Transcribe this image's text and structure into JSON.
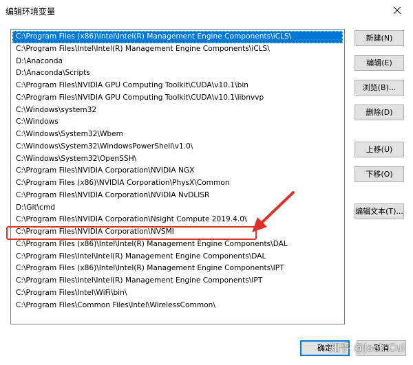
{
  "window": {
    "title": "编辑环境变量"
  },
  "paths": [
    "C:\\Program Files (x86)\\Intel\\Intel(R) Management Engine Components\\iCLS\\",
    "C:\\Program Files\\Intel\\Intel(R) Management Engine Components\\iCLS\\",
    "D:\\Anaconda",
    "D:\\Anaconda\\Scripts",
    "C:\\Program Files\\NVIDIA GPU Computing Toolkit\\CUDA\\v10.1\\bin",
    "C:\\Program Files\\NVIDIA GPU Computing Toolkit\\CUDA\\v10.1\\libnvvp",
    "C:\\Windows\\system32",
    "C:\\Windows",
    "C:\\Windows\\System32\\Wbem",
    "C:\\Windows\\System32\\WindowsPowerShell\\v1.0\\",
    "C:\\Windows\\System32\\OpenSSH\\",
    "C:\\Program Files\\NVIDIA Corporation\\NVIDIA NGX",
    "C:\\Program Files (x86)\\NVIDIA Corporation\\PhysX\\Common",
    "C:\\Program Files\\NVIDIA Corporation\\NVIDIA NvDLISR",
    "D:\\Git\\cmd",
    "C:\\Program Files\\NVIDIA Corporation\\Nsight Compute 2019.4.0\\",
    "C:\\Program Files\\NVIDIA Corporation\\NVSMI",
    "C:\\Program Files (x86)\\Intel\\Intel(R) Management Engine Components\\DAL",
    "C:\\Program Files\\Intel\\Intel(R) Management Engine Components\\DAL",
    "C:\\Program Files (x86)\\Intel\\Intel(R) Management Engine Components\\IPT",
    "C:\\Program Files\\Intel\\Intel(R) Management Engine Components\\IPT",
    "C:\\Program Files\\Intel\\WiFi\\bin\\",
    "C:\\Program Files\\Common Files\\Intel\\WirelessCommon\\"
  ],
  "selected_index": 0,
  "highlighted_index": 16,
  "buttons": {
    "new": "新建(N)",
    "edit": "编辑(E)",
    "browse": "浏览(B)...",
    "delete": "删除(D)",
    "move_up": "上移(U)",
    "move_down": "下移(O)",
    "edit_text": "编辑文本(T)...",
    "ok": "确定",
    "cancel": "取消"
  },
  "annotation_color": "#e0302a",
  "selection_color": "#0078d7",
  "watermark": "知乎 @Jack Cui"
}
